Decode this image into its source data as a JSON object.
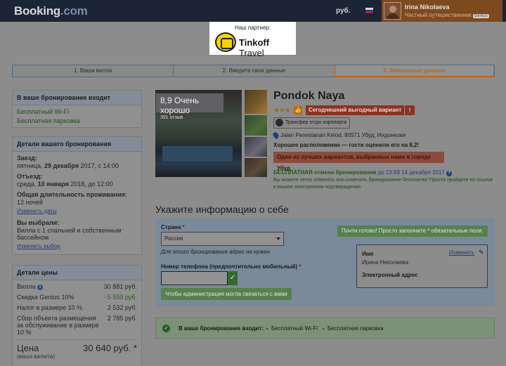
{
  "header": {
    "logo_main": "Booking",
    "logo_dom": ".com",
    "currency": "руб.",
    "user_name": "Irina Nikolaeva",
    "user_status": "Частный путешественник",
    "genius": "Genius"
  },
  "partner": {
    "title": "Наш партнер:",
    "name_bold": "Tinkoff",
    "name_rest": " Travel"
  },
  "steps": [
    {
      "label": "1. Ваша вилла"
    },
    {
      "label": "2. Введите свои данные"
    },
    {
      "label": "3. Финальные данные"
    }
  ],
  "sidebar": {
    "included": {
      "title": "В ваше бронирование входит",
      "items": [
        "Бесплатный Wi-Fi",
        "Бесплатная парковка"
      ]
    },
    "details": {
      "title": "Детали вашего бронирования",
      "checkin_label": "Заезд:",
      "checkin_pre": "пятница, ",
      "checkin_date": "29 декабря",
      "checkin_post": " 2017, с 14:00",
      "checkout_label": "Отъезд:",
      "checkout_pre": "среда, ",
      "checkout_date": "10 января",
      "checkout_post": " 2018, до 12:00",
      "duration_label": "Общая длительность проживания:",
      "duration_value": "12 ночей",
      "change_dates": "Изменить даты",
      "chosen_label": "Вы выбрали:",
      "chosen_value": "Вилла с 1 спальней и собственным бассейном",
      "change_choice": "Изменить выбор"
    },
    "price": {
      "title": "Детали цены",
      "rows": [
        {
          "label": "Вилла",
          "value": "30 881 руб."
        },
        {
          "label": "Скидка Genius 10%",
          "value": "- 5 559 руб."
        },
        {
          "label": "Налог в размере 10 %",
          "value": "2 532 руб."
        },
        {
          "label": "Сбор объекта размещения за обслуживание в размере 10 %",
          "value": "2 785 руб."
        }
      ],
      "total_label": "Цена",
      "total_value": "30 640 руб. *",
      "total_sub": "(ваша валюта)"
    }
  },
  "hotel": {
    "score": "8,9 Очень хорошо",
    "reviews": "391 отзыв",
    "name": "Pondok Naya",
    "stars": "★★★",
    "deal": "Сегодняшний выгодный вариант",
    "transfer": "Трансфер от/до аэропорта",
    "address": "Jalan Penestanan Kelod, 80571 Убуд, Индонезия",
    "location": "Хорошее расположение — гости оценили его на 8,2!",
    "best": "Один из лучших вариантов, выбранных нами в городе Убуд",
    "free_cancel_bold": "БЕСПЛАТНАЯ отмена бронирования",
    "free_cancel_date": " до 23:59 14 декабря 2017",
    "free_cancel_text": "Вы можете легко отменить или изменить бронирование бесплатно! Просто пройдите по ссылке в вашем электронном подтверждении."
  },
  "form": {
    "title": "Укажите информацию о себе",
    "ready": "Почти готово! Просто заполните * обязательные поля.",
    "country_label": "Страна",
    "country_value": "Россия",
    "country_hint": "Для этого бронирования адрес не нужен",
    "phone_label": "Номер телефона (предпочтительно мобильный)",
    "phone_value": "",
    "tip": "Чтобы администрация могла связаться с вами",
    "guest": {
      "name_label": "Имя",
      "name_value": "Ирина Николаева",
      "email_label": "Электронный адрес",
      "change": "Изменить"
    }
  },
  "included_bar": {
    "title": "В ваше бронирование входит:",
    "items": [
      "Бесплатный Wi-Fi",
      "Бесплатная парковка"
    ]
  }
}
